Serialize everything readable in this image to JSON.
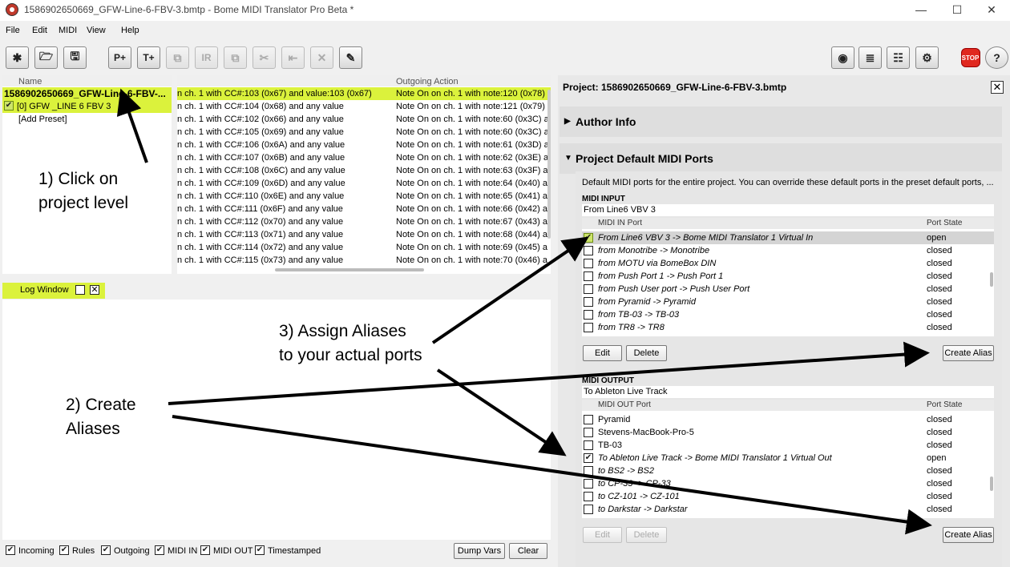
{
  "window": {
    "title": "1586902650669_GFW-Line-6-FBV-3.bmtp - Bome MIDI Translator Pro Beta *",
    "min": "—",
    "max": "☐",
    "close": "✕"
  },
  "menu": [
    "File",
    "Edit",
    "MIDI",
    "View",
    "Help"
  ],
  "toolbar": {
    "left": [
      "✱",
      "🗁",
      "🖫",
      "P+",
      "T+",
      "⧉",
      "IR",
      "⧉",
      "✂",
      "⇤",
      "✕",
      "✎"
    ],
    "right": [
      "◉",
      "≣",
      "☷",
      "⚙",
      "STOP",
      "?"
    ]
  },
  "presets": {
    "header": "Name",
    "project": "1586902650669_GFW-Line-6-FBV-...",
    "preset": "[0] GFW _LINE 6 FBV 3",
    "add": "[Add Preset]"
  },
  "translators": {
    "header_out": "Outgoing Action",
    "rows": [
      {
        "in": "n ch. 1 with CC#:103 (0x67) and value:103 (0x67)",
        "out": "Note On on ch. 1 with note:120 (0x78)"
      },
      {
        "in": "n ch. 1 with CC#:104 (0x68) and any value",
        "out": "Note On on ch. 1 with note:121 (0x79)"
      },
      {
        "in": "n ch. 1 with CC#:102 (0x66) and any value",
        "out": "Note On on ch. 1 with note:60 (0x3C) a"
      },
      {
        "in": "n ch. 1 with CC#:105 (0x69) and any value",
        "out": "Note On on ch. 1 with note:60 (0x3C) a"
      },
      {
        "in": "n ch. 1 with CC#:106 (0x6A) and any value",
        "out": "Note On on ch. 1 with note:61 (0x3D) a"
      },
      {
        "in": "n ch. 1 with CC#:107 (0x6B) and any value",
        "out": "Note On on ch. 1 with note:62 (0x3E) a"
      },
      {
        "in": "n ch. 1 with CC#:108 (0x6C) and any value",
        "out": "Note On on ch. 1 with note:63 (0x3F) a"
      },
      {
        "in": "n ch. 1 with CC#:109 (0x6D) and any value",
        "out": "Note On on ch. 1 with note:64 (0x40) a"
      },
      {
        "in": "n ch. 1 with CC#:110 (0x6E) and any value",
        "out": "Note On on ch. 1 with note:65 (0x41) a"
      },
      {
        "in": "n ch. 1 with CC#:111 (0x6F) and any value",
        "out": "Note On on ch. 1 with note:66 (0x42) a"
      },
      {
        "in": "n ch. 1 with CC#:112 (0x70) and any value",
        "out": "Note On on ch. 1 with note:67 (0x43) a"
      },
      {
        "in": "n ch. 1 with CC#:113 (0x71) and any value",
        "out": "Note On on ch. 1 with note:68 (0x44) a"
      },
      {
        "in": "n ch. 1 with CC#:114 (0x72) and any value",
        "out": "Note On on ch. 1 with note:69 (0x45) a"
      },
      {
        "in": "n ch. 1 with CC#:115 (0x73) and any value",
        "out": "Note On on ch. 1 with note:70 (0x46) a"
      }
    ]
  },
  "log": {
    "title": "Log Window",
    "footer": [
      "Incoming",
      "Rules",
      "Outgoing",
      "MIDI IN",
      "MIDI OUT",
      "Timestamped"
    ],
    "dump": "Dump Vars",
    "clear": "Clear"
  },
  "project": {
    "header": "Project: 1586902650669_GFW-Line-6-FBV-3.bmtp",
    "author": "Author Info",
    "ports_section": "Project Default MIDI Ports",
    "desc": "Default MIDI ports for the entire project. You can override these default ports in the preset default ports, ...",
    "midi_in": {
      "label": "MIDI INPUT",
      "value": "From Line6 VBV 3",
      "col_port": "MIDI IN Port",
      "col_state": "Port State",
      "rows": [
        {
          "name": "From Line6 VBV 3 -> Bome MIDI Translator 1 Virtual In",
          "state": "open",
          "checked": true
        },
        {
          "name": "from Monotribe -> Monotribe",
          "state": "closed",
          "checked": false
        },
        {
          "name": "from MOTU via BomeBox DIN",
          "state": "closed",
          "checked": false
        },
        {
          "name": "from Push Port 1 -> Push Port 1",
          "state": "closed",
          "checked": false
        },
        {
          "name": "from Push User port -> Push User Port",
          "state": "closed",
          "checked": false
        },
        {
          "name": "from Pyramid -> Pyramid",
          "state": "closed",
          "checked": false
        },
        {
          "name": "from TB-03 -> TB-03",
          "state": "closed",
          "checked": false
        },
        {
          "name": "from TR8 -> TR8",
          "state": "closed",
          "checked": false
        }
      ],
      "edit": "Edit",
      "delete": "Delete",
      "create": "Create Alias"
    },
    "midi_out": {
      "label": "MIDI OUTPUT",
      "value": "To Ableton Live Track",
      "col_port": "MIDI OUT Port",
      "col_state": "Port State",
      "rows": [
        {
          "name": "Pyramid",
          "state": "closed",
          "checked": false
        },
        {
          "name": "Stevens-MacBook-Pro-5",
          "state": "closed",
          "checked": false
        },
        {
          "name": "TB-03",
          "state": "closed",
          "checked": false
        },
        {
          "name": "To Ableton Live Track -> Bome MIDI Translator 1 Virtual Out",
          "state": "open",
          "checked": true
        },
        {
          "name": "to BS2 -> BS2",
          "state": "closed",
          "checked": false
        },
        {
          "name": "to CP-33 -> CP-33",
          "state": "closed",
          "checked": false
        },
        {
          "name": "to CZ-101 -> CZ-101",
          "state": "closed",
          "checked": false
        },
        {
          "name": "to Darkstar -> Darkstar",
          "state": "closed",
          "checked": false
        }
      ],
      "edit": "Edit",
      "delete": "Delete",
      "create": "Create Alias"
    }
  },
  "annotations": {
    "a1_line1": "1) Click on",
    "a1_line2": "project level",
    "a2_line1": "2) Create",
    "a2_line2": "Aliases",
    "a3_line1": "3) Assign Aliases",
    "a3_line2": "to your actual ports"
  }
}
